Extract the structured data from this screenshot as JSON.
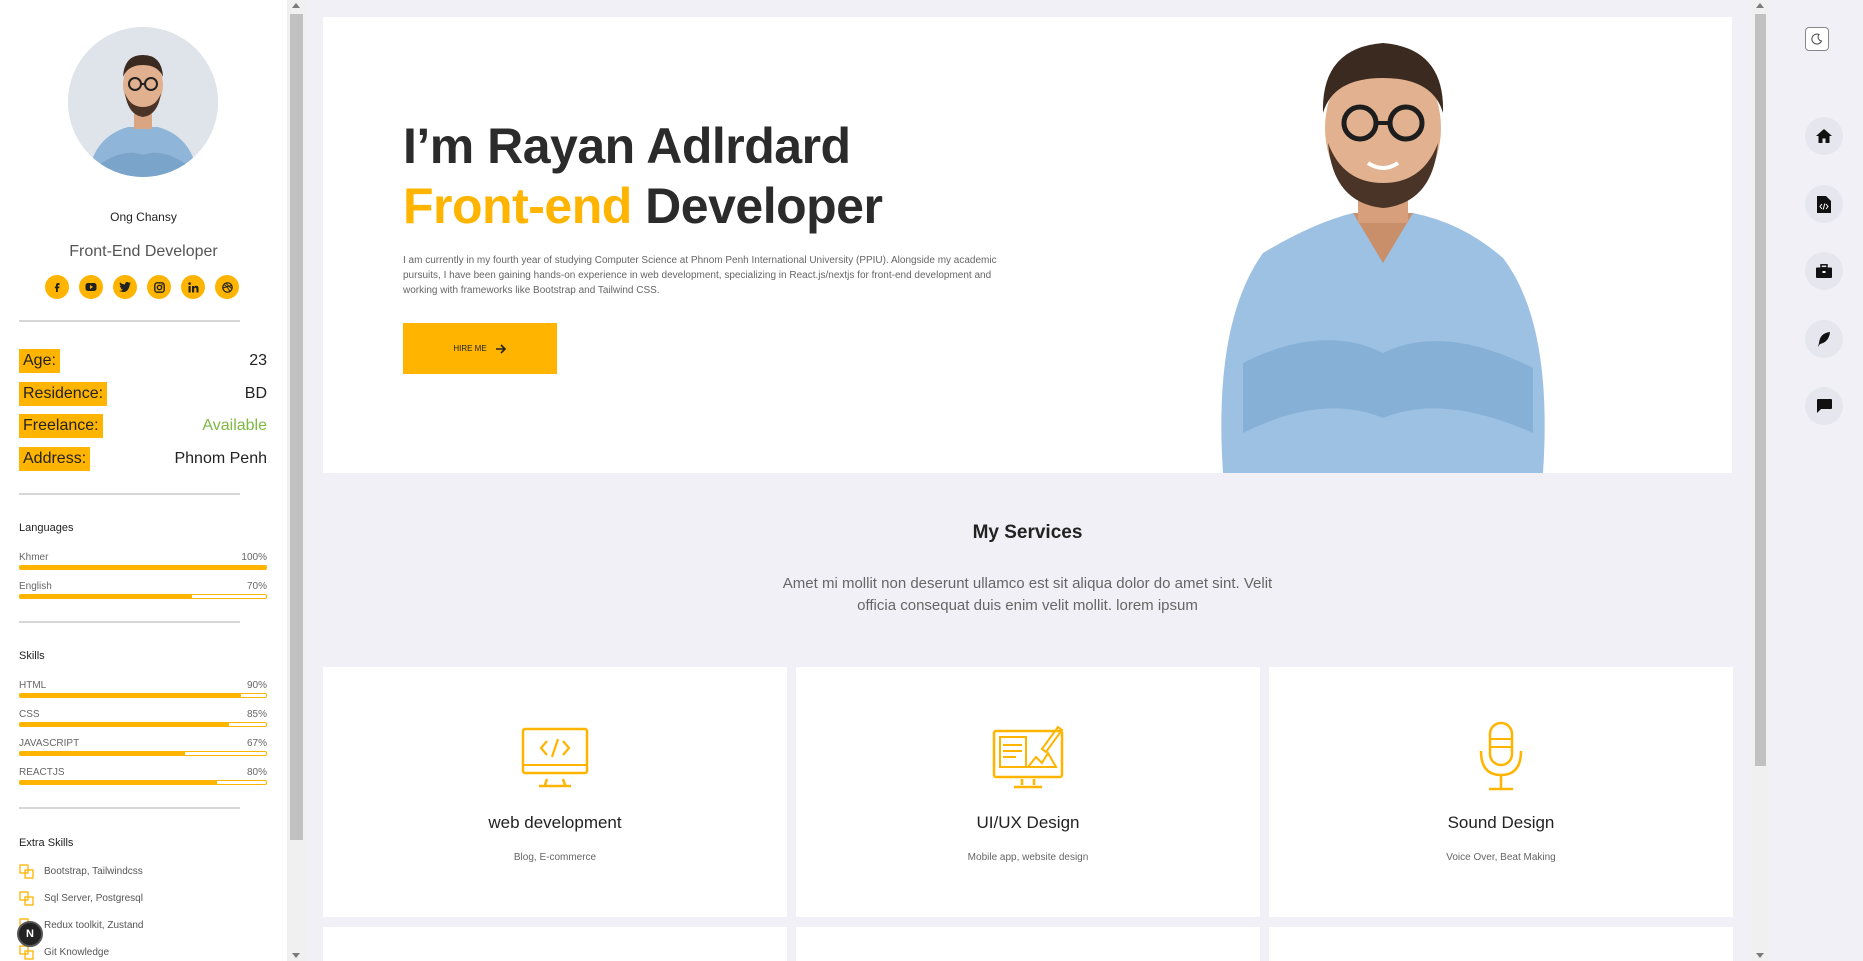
{
  "profile": {
    "name": "Ong Chansy",
    "role": "Front-End Developer",
    "socials": [
      "facebook-icon",
      "youtube-icon",
      "twitter-icon",
      "instagram-icon",
      "linkedin-icon",
      "dribbble-icon"
    ]
  },
  "info": [
    {
      "label": "Age:",
      "value": "23"
    },
    {
      "label": "Residence:",
      "value": "BD"
    },
    {
      "label": "Freelance:",
      "value": "Available"
    },
    {
      "label": "Address:",
      "value": "Phnom Penh"
    }
  ],
  "languages": {
    "title": "Languages",
    "items": [
      {
        "name": "Khmer",
        "pct": "100%",
        "level": 100
      },
      {
        "name": "English",
        "pct": "70%",
        "level": 70
      }
    ]
  },
  "skills": {
    "title": "Skills",
    "items": [
      {
        "name": "HTML",
        "pct": "90%",
        "level": 90
      },
      {
        "name": "CSS",
        "pct": "85%",
        "level": 85
      },
      {
        "name": "JAVASCRIPT",
        "pct": "67%",
        "level": 67
      },
      {
        "name": "REACTJS",
        "pct": "80%",
        "level": 80
      }
    ]
  },
  "extra_skills": {
    "title": "Extra Skills",
    "items": [
      "Bootstrap, Tailwindcss",
      "Sql Server, Postgresql",
      "Redux toolkit, Zustand",
      "Git Knowledge"
    ]
  },
  "nav_badge": "N",
  "hero": {
    "line1": "I’m Rayan Adlrdard",
    "line2_accent": "Front-end",
    "line2_rest": " Developer",
    "description": "I am currently in my fourth year of studying Computer Science at Phnom Penh International University (PPIU). Alongside my academic pursuits, I have been gaining hands-on experience in web development, specializing in React.js/nextjs for front-end development and working with frameworks like Bootstrap and Tailwind CSS.",
    "button": "HIRE ME"
  },
  "services": {
    "title": "My Services",
    "description": "Amet mi mollit non deserunt ullamco est sit aliqua dolor do amet sint. Velit officia consequat duis enim velit mollit. lorem ipsum",
    "cards": [
      {
        "name": "web development",
        "sub": "Blog, E-commerce",
        "icon": "code-monitor-icon"
      },
      {
        "name": "UI/UX Design",
        "sub": "Mobile app, website design",
        "icon": "design-monitor-icon"
      },
      {
        "name": "Sound Design",
        "sub": "Voice Over, Beat Making",
        "icon": "microphone-icon"
      }
    ]
  },
  "rail": [
    "home-icon",
    "code-file-icon",
    "briefcase-icon",
    "feather-icon",
    "chat-icon"
  ],
  "colors": {
    "accent": "#ffb400",
    "green": "#7eb942",
    "bg": "#f0f0f6"
  }
}
